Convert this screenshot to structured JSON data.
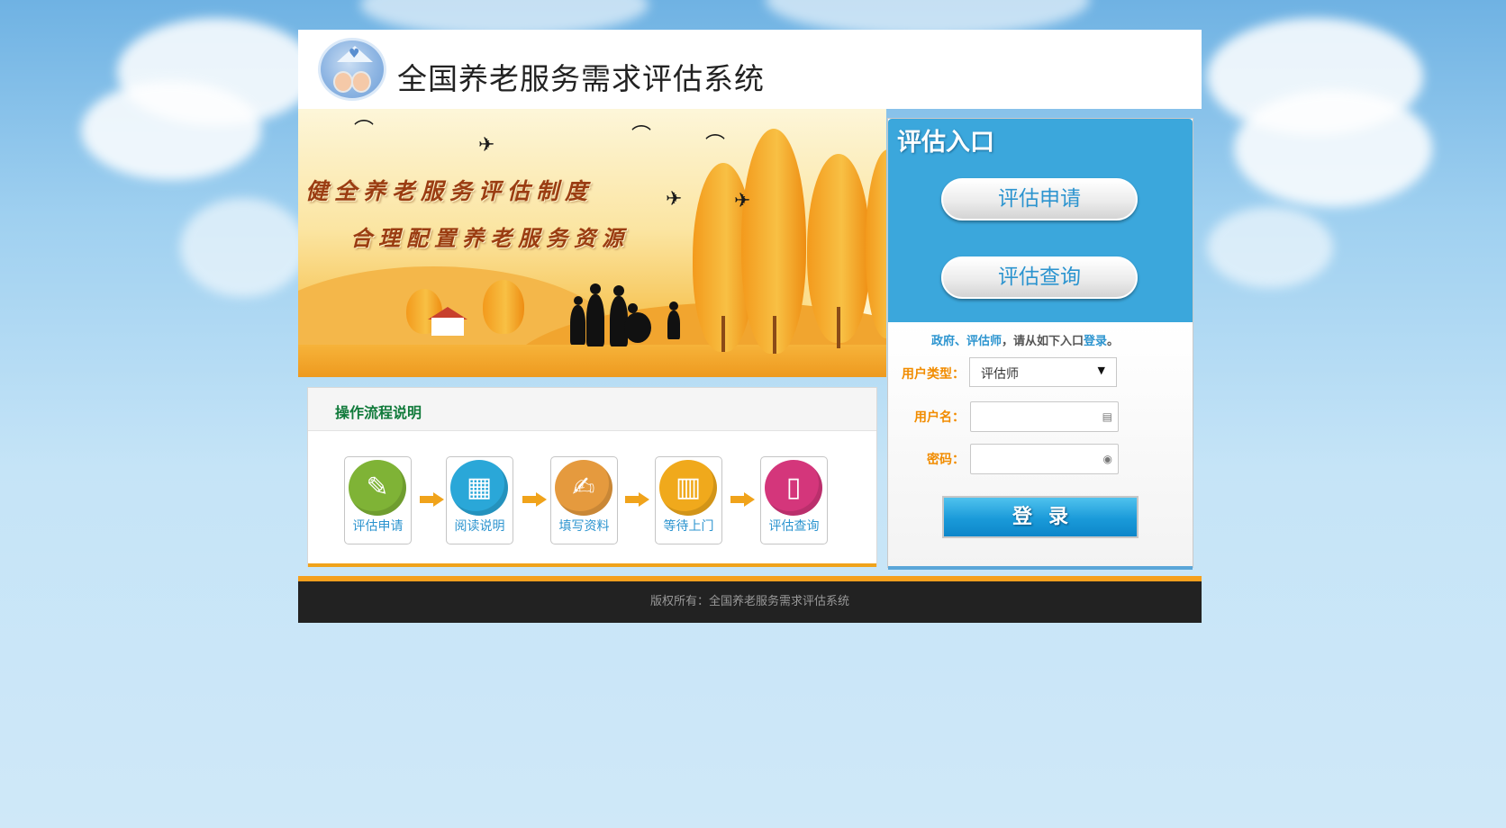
{
  "colors": {
    "accent_blue": "#3ba7dc",
    "accent_orange": "#f0a31b",
    "label_orange": "#f18c00",
    "title_green": "#107a3a",
    "footer_bg": "#222222"
  },
  "header": {
    "title": "全国养老服务需求评估系统",
    "logo_icon": "elderly-couple-house-logo"
  },
  "banner": {
    "slogan_line1": "健全养老服务评估制度",
    "slogan_line2": "合理配置养老服务资源"
  },
  "login": {
    "heading": "评估入口",
    "apply_button": "评估申请",
    "query_button": "评估查询",
    "notice": {
      "part1": "政府、评估师",
      "part2": "，请从如下入口",
      "part3": "登录",
      "part4": "。"
    },
    "user_type_label": "用户类型：",
    "user_type_value": "评估师",
    "username_label": "用户名：",
    "username_value": "",
    "password_label": "密码：",
    "password_value": "",
    "submit_label": "登录"
  },
  "process": {
    "title": "操作流程说明",
    "steps": [
      {
        "label": "评估申请",
        "icon": "pencil-icon",
        "color": "#7fb336"
      },
      {
        "label": "阅读说明",
        "icon": "document-icon",
        "color": "#2aa7d8"
      },
      {
        "label": "填写资料",
        "icon": "edit-form-icon",
        "color": "#e59a3e"
      },
      {
        "label": "等待上门",
        "icon": "building-icon",
        "color": "#f0a91c"
      },
      {
        "label": "评估查询",
        "icon": "tablet-icon",
        "color": "#d4367b"
      }
    ]
  },
  "footer": {
    "copyright": "版权所有：全国养老服务需求评估系统"
  }
}
